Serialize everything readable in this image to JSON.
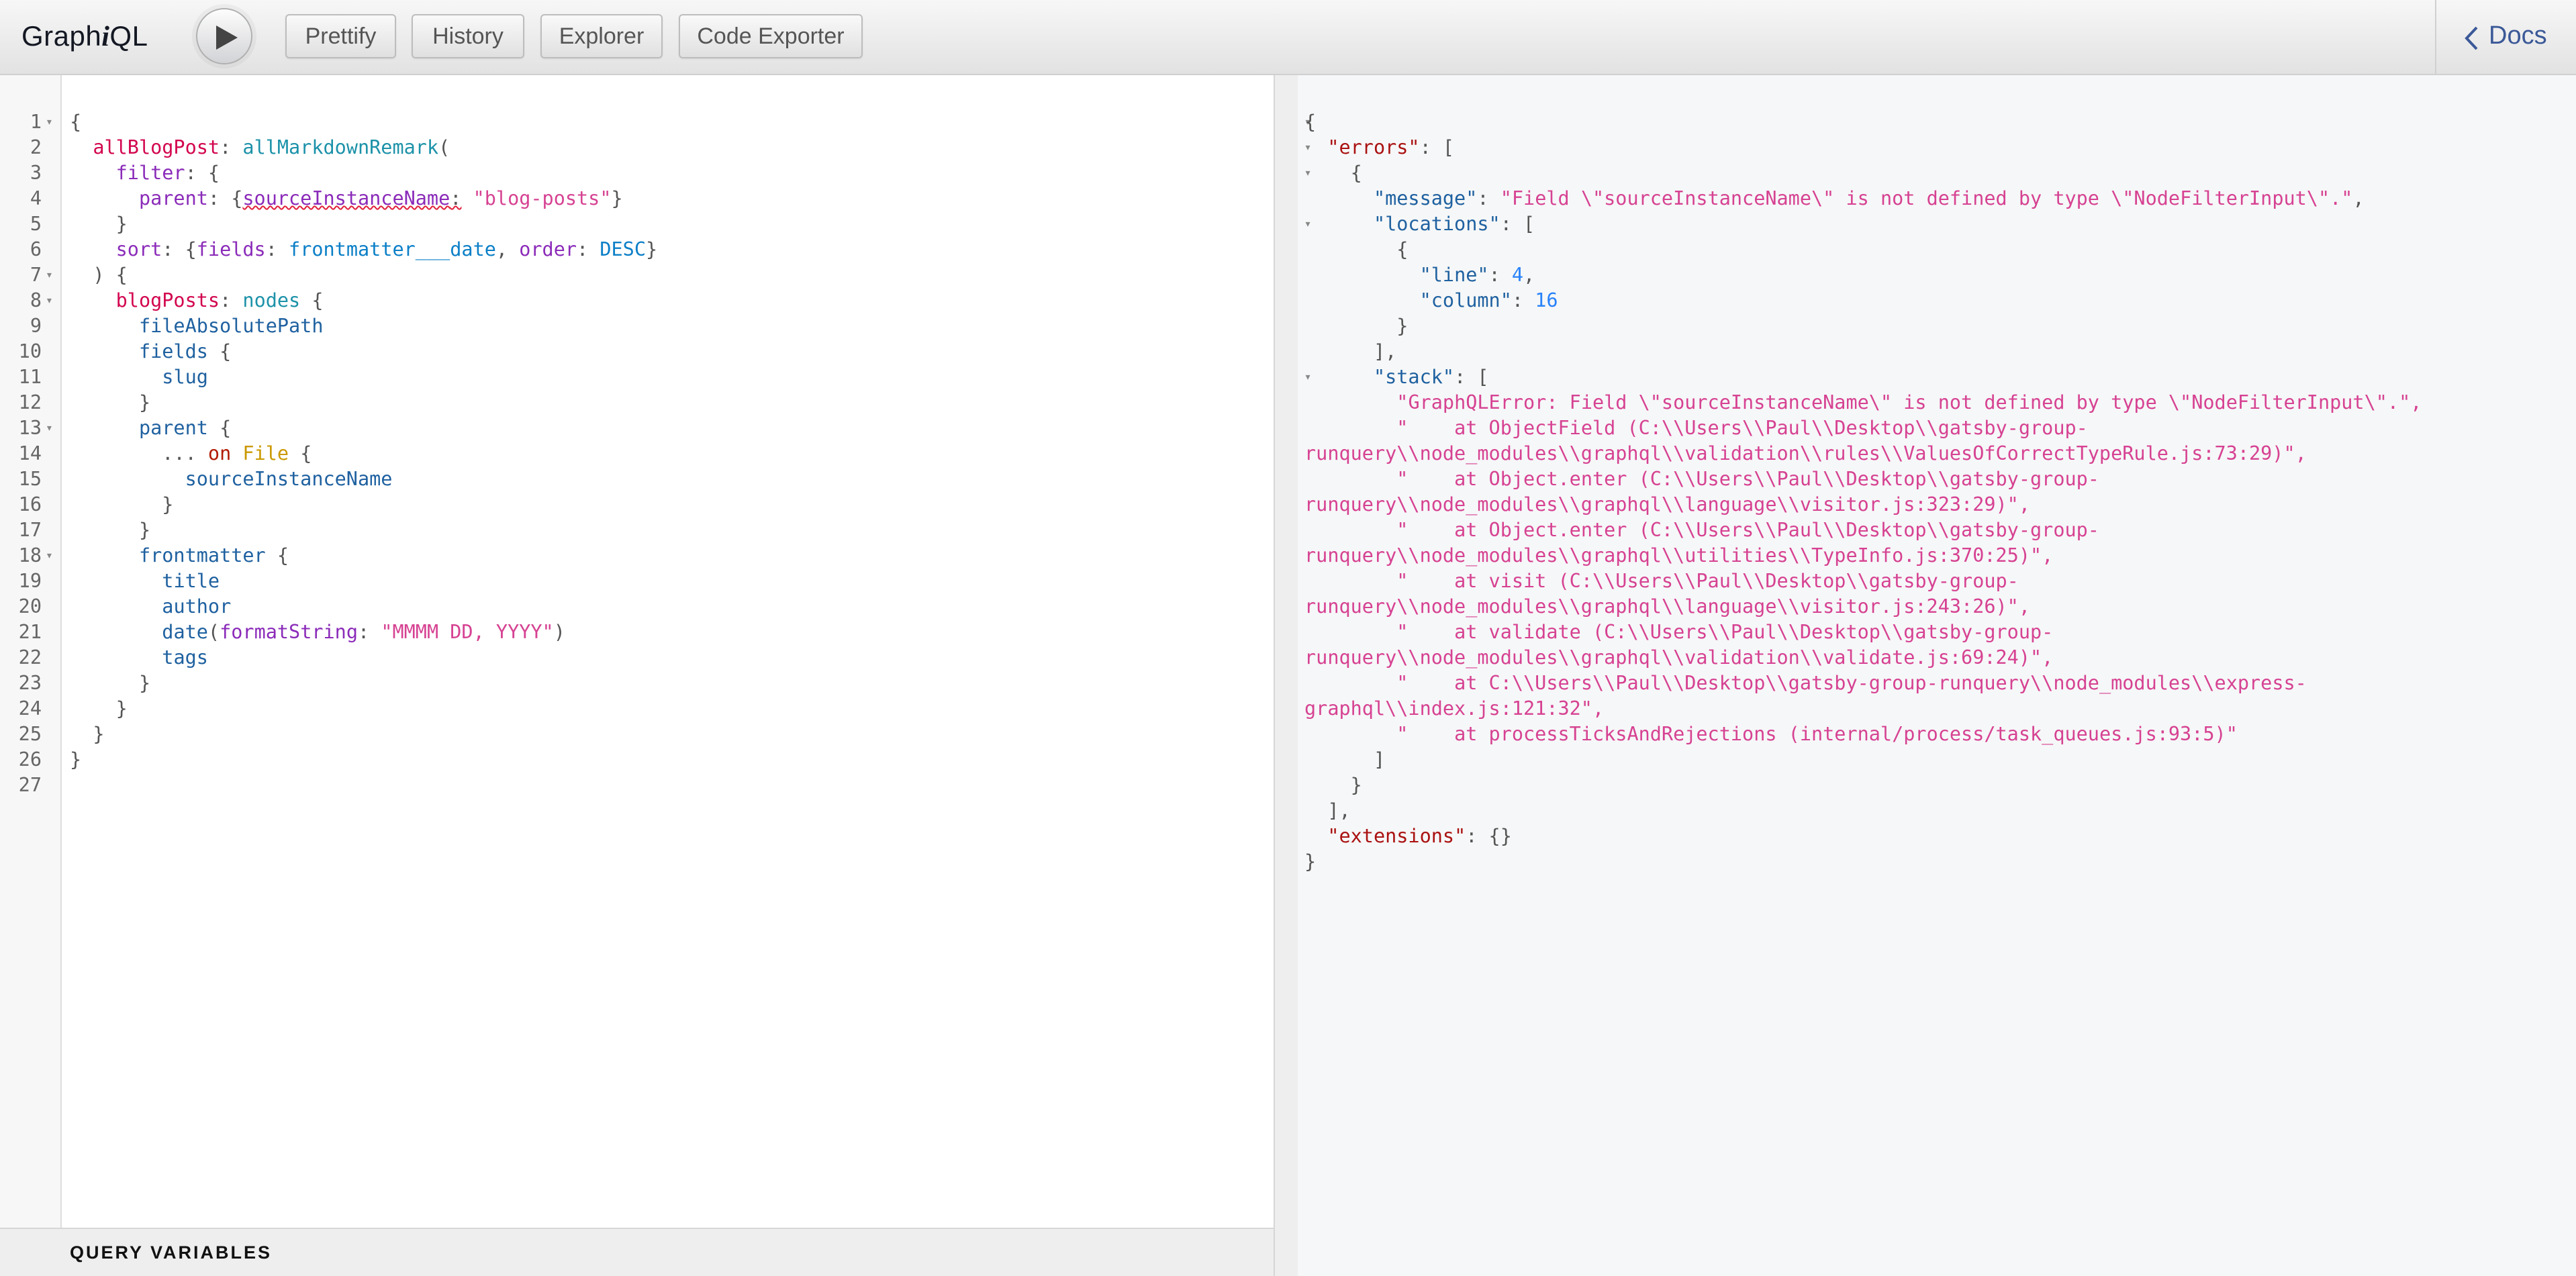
{
  "header": {
    "logo_pre": "Graph",
    "logo_i": "i",
    "logo_post": "QL",
    "buttons": [
      "Prettify",
      "History",
      "Explorer",
      "Code Exporter"
    ],
    "docs_label": "Docs",
    "execute_icon": "play-icon",
    "docs_icon": "chevron-left-icon"
  },
  "query_variables_label": "QUERY VARIABLES",
  "editor": {
    "line_numbers": [
      "1",
      "2",
      "3",
      "4",
      "5",
      "6",
      "7",
      "8",
      "9",
      "10",
      "11",
      "12",
      "13",
      "14",
      "15",
      "16",
      "17",
      "18",
      "19",
      "20",
      "21",
      "22",
      "23",
      "24",
      "25",
      "26",
      "27"
    ],
    "tokens": {
      "allBlogPost": "allBlogPost",
      "allMarkdownRemark": "allMarkdownRemark",
      "filter": "filter",
      "parent": "parent",
      "sourceInstanceName": "sourceInstanceName",
      "blog_posts": "\"blog-posts\"",
      "sort": "sort",
      "fields": "fields",
      "frontmatter___date": "frontmatter___date",
      "order": "order",
      "DESC": "DESC",
      "blogPosts": "blogPosts",
      "nodes": "nodes",
      "fileAbsolutePath": "fileAbsolutePath",
      "slug": "slug",
      "on": "on",
      "File": "File",
      "frontmatter": "frontmatter",
      "title": "title",
      "author": "author",
      "date": "date",
      "formatString": "formatString",
      "format_value": "\"MMMM DD, YYYY\"",
      "tags": "tags"
    }
  },
  "result": {
    "errors_key": "\"errors\"",
    "message_key": "\"message\"",
    "message_value": "\"Field \\\"sourceInstanceName\\\" is not defined by type \\\"NodeFilterInput\\\".\"",
    "locations_key": "\"locations\"",
    "line_key": "\"line\"",
    "line_value": "4",
    "column_key": "\"column\"",
    "column_value": "16",
    "stack_key": "\"stack\"",
    "stack_lines": [
      "\"GraphQLError: Field \\\"sourceInstanceName\\\" is not defined by type \\\"NodeFilterInput\\\".\",",
      "\"    at ObjectField (C:\\\\Users\\\\Paul\\\\Desktop\\\\gatsby-group-",
      "runquery\\\\node_modules\\\\graphql\\\\validation\\\\rules\\\\ValuesOfCorrectTypeRule.js:73:29)\",",
      "\"    at Object.enter (C:\\\\Users\\\\Paul\\\\Desktop\\\\gatsby-group-",
      "runquery\\\\node_modules\\\\graphql\\\\language\\\\visitor.js:323:29)\",",
      "\"    at Object.enter (C:\\\\Users\\\\Paul\\\\Desktop\\\\gatsby-group-",
      "runquery\\\\node_modules\\\\graphql\\\\utilities\\\\TypeInfo.js:370:25)\",",
      "\"    at visit (C:\\\\Users\\\\Paul\\\\Desktop\\\\gatsby-group-",
      "runquery\\\\node_modules\\\\graphql\\\\language\\\\visitor.js:243:26)\",",
      "\"    at validate (C:\\\\Users\\\\Paul\\\\Desktop\\\\gatsby-group-",
      "runquery\\\\node_modules\\\\graphql\\\\validation\\\\validate.js:69:24)\",",
      "\"    at C:\\\\Users\\\\Paul\\\\Desktop\\\\gatsby-group-runquery\\\\node_modules\\\\express-",
      "graphql\\\\index.js:121:32\",",
      "\"    at processTicksAndRejections (internal/process/task_queues.js:93:5)\""
    ],
    "extensions_key": "\"extensions\""
  }
}
